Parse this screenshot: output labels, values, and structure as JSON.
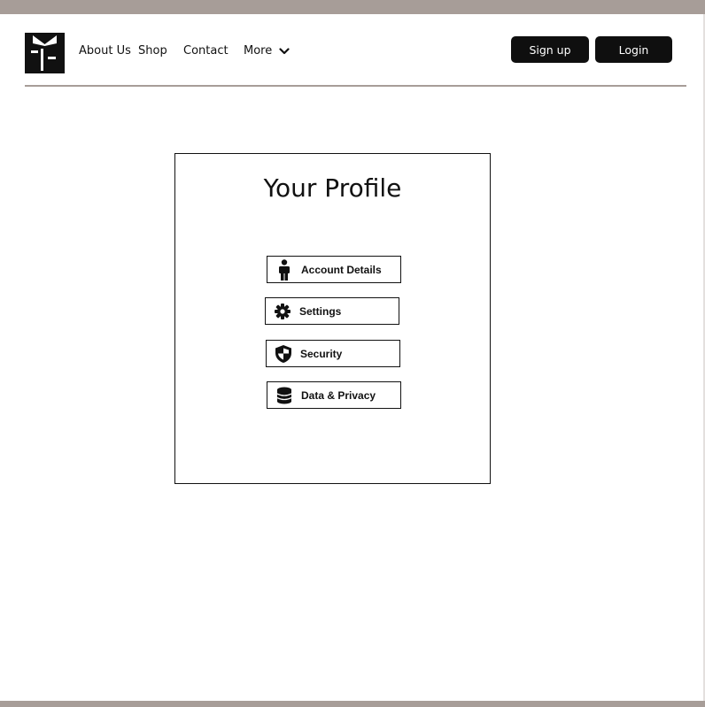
{
  "header": {
    "nav": [
      {
        "label": "About Us"
      },
      {
        "label": "Shop"
      },
      {
        "label": "Contact"
      },
      {
        "label": "More"
      }
    ],
    "signup_label": "Sign up",
    "login_label": "Login"
  },
  "profile": {
    "title": "Your Profile",
    "items": [
      {
        "label": "Account Details",
        "icon": "person-icon"
      },
      {
        "label": "Settings",
        "icon": "gear-icon"
      },
      {
        "label": "Security",
        "icon": "shield-icon"
      },
      {
        "label": "Data & Privacy",
        "icon": "database-icon"
      }
    ]
  },
  "colors": {
    "frame_bar": "#a79d98",
    "button_dark": "#0f0f0f"
  }
}
